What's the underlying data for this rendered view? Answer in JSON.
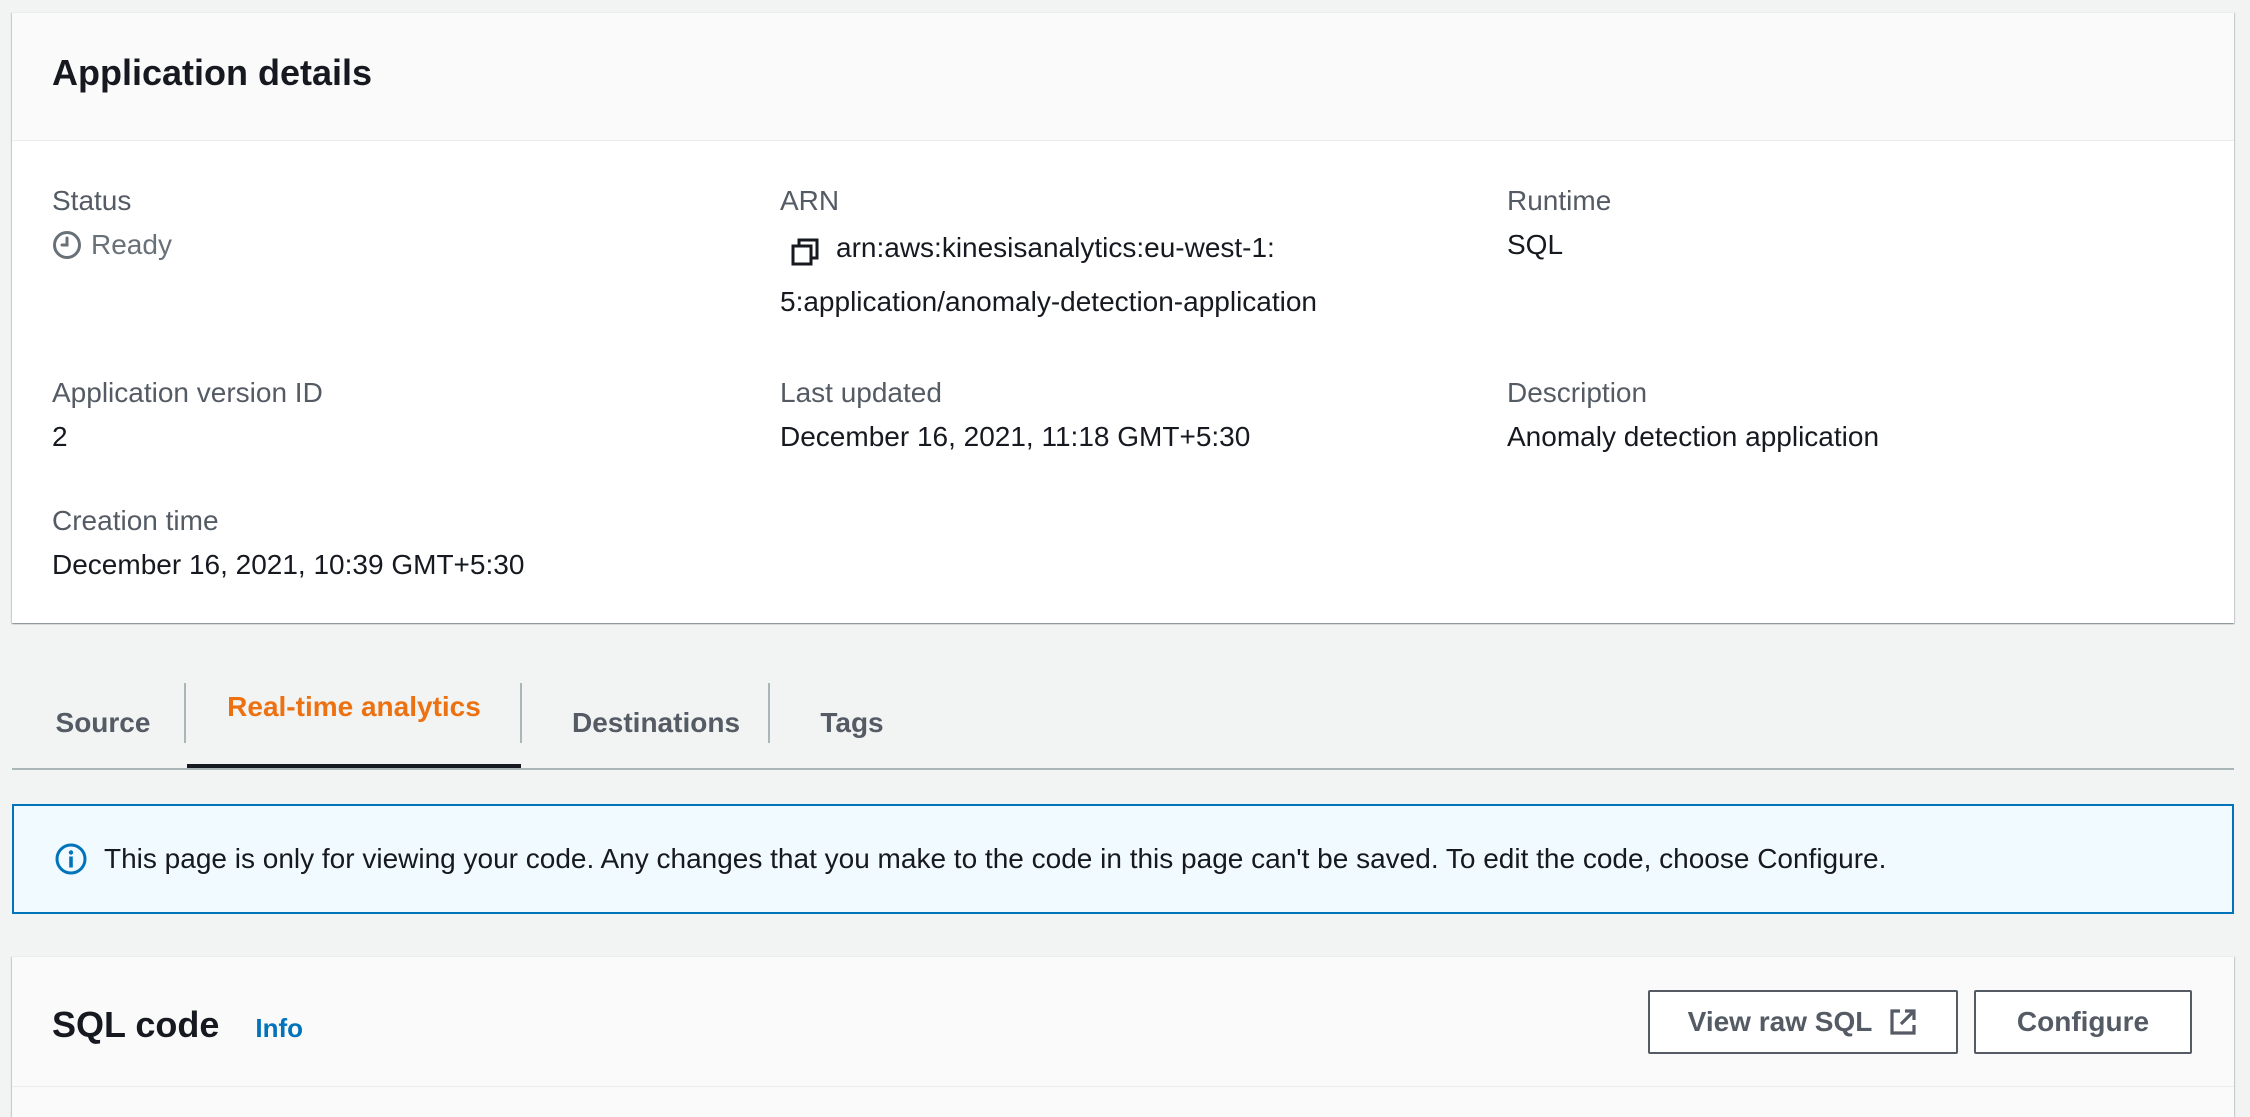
{
  "details": {
    "title": "Application details",
    "status_label": "Status",
    "status_value": "Ready",
    "arn_label": "ARN",
    "arn_line1": "arn:aws:kinesisanalytics:eu-west-1:",
    "arn_line2": "5:application/anomaly-detection-application",
    "runtime_label": "Runtime",
    "runtime_value": "SQL",
    "version_label": "Application version ID",
    "version_value": "2",
    "updated_label": "Last updated",
    "updated_value": "December 16, 2021, 11:18 GMT+5:30",
    "description_label": "Description",
    "description_value": "Anomaly detection application",
    "creation_label": "Creation time",
    "creation_value": "December 16, 2021, 10:39 GMT+5:30"
  },
  "tabs": [
    {
      "label": "Source",
      "active": false
    },
    {
      "label": "Real-time analytics",
      "active": true
    },
    {
      "label": "Destinations",
      "active": false
    },
    {
      "label": "Tags",
      "active": false
    }
  ],
  "alert": {
    "text": "This page is only for viewing your code. Any changes that you make to the code in this page can't be saved. To edit the code, choose Configure."
  },
  "sql": {
    "title": "SQL code",
    "info_link": "Info",
    "view_raw_label": "View raw SQL",
    "configure_label": "Configure"
  },
  "icons": {
    "status": "clock-icon",
    "copy": "copy-icon",
    "info": "info-circle-icon",
    "external": "external-link-icon"
  },
  "colors": {
    "accent_active_tab": "#ec7211",
    "link_blue": "#0073bb",
    "alert_bg": "#f1faff",
    "text_secondary": "#545b64"
  }
}
